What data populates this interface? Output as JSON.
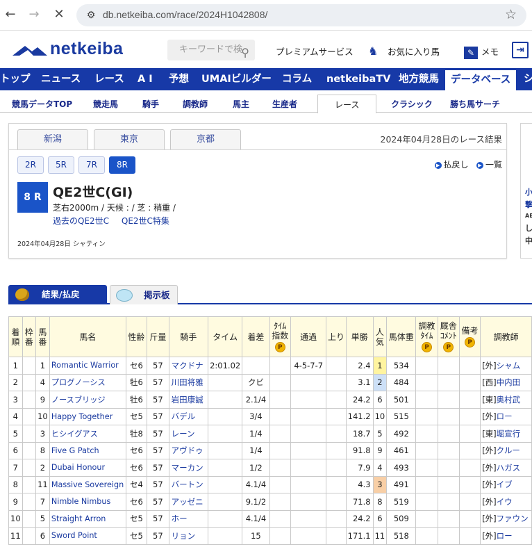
{
  "browser": {
    "url": "db.netkeiba.com/race/2024H1042808/"
  },
  "header": {
    "logo": "netkeiba",
    "search_placeholder": "キーワードで検",
    "premium": "プレミアムサービス",
    "favorites": "お気に入り馬",
    "memo": "メモ"
  },
  "gnav": [
    "トップ",
    "ニュース",
    "レース",
    "A I",
    "予想",
    "UMAIビルダー",
    "コラム",
    "netkeibaTV",
    "地方競馬",
    "データベース",
    "シ"
  ],
  "snav": [
    "競馬データTOP",
    "競走馬",
    "騎手",
    "調教師",
    "馬主",
    "生産者",
    "レース",
    "クラシック",
    "勝ち馬サーチ"
  ],
  "race": {
    "venues": [
      "新潟",
      "東京",
      "京都"
    ],
    "date_result": "2024年04月28日のレース結果",
    "race_tabs": [
      "2R",
      "5R",
      "7R",
      "8R"
    ],
    "link_payout": "払戻し",
    "link_list": "一覧",
    "race_number": "8 R",
    "race_name": "QE2世C(GI)",
    "race_data": "芝右2000m /  天候 :  /  芝 : 稍重  /",
    "past_link": "過去のQE2世C",
    "special_link": "QE2世C特集",
    "info": "2024年04月28日 シャティン"
  },
  "rightad": [
    "小",
    "撃",
    "AE",
    "し",
    "中"
  ],
  "tabs": {
    "result": "結果/払戻",
    "board": "掲示板"
  },
  "table": {
    "headers": [
      "着\n順",
      "枠\n番",
      "馬\n番",
      "馬名",
      "性齢",
      "斤量",
      "騎手",
      "タイム",
      "着差",
      "ﾀｲﾑ\n指数",
      "通過",
      "上り",
      "単勝",
      "人\n気",
      "馬体重",
      "調教\nﾀｲﾑ",
      "厩舎\nｺﾒﾝﾄ",
      "備考",
      "調教師"
    ],
    "premium_mark": "P",
    "rows": [
      {
        "rank": "1",
        "waku": "",
        "num": "1",
        "horse": "Romantic Warrior",
        "sexage": "セ6",
        "weight": "57",
        "jockey": "マクドナ",
        "time": "2:01.02",
        "margin": "",
        "pass": "4-5-7-7",
        "odds": "2.4",
        "pop": "1",
        "body": "534",
        "trainer_region": "[外]",
        "trainer": "シャム"
      },
      {
        "rank": "2",
        "waku": "",
        "num": "4",
        "horse": "プログノーシス",
        "sexage": "牡6",
        "weight": "57",
        "jockey": "川田将雅",
        "time": "",
        "margin": "クビ",
        "pass": "",
        "odds": "3.1",
        "pop": "2",
        "body": "484",
        "trainer_region": "[西]",
        "trainer": "中内田"
      },
      {
        "rank": "3",
        "waku": "",
        "num": "9",
        "horse": "ノースブリッジ",
        "sexage": "牡6",
        "weight": "57",
        "jockey": "岩田康誠",
        "time": "",
        "margin": "2.1/4",
        "pass": "",
        "odds": "24.2",
        "pop": "6",
        "body": "501",
        "trainer_region": "[東]",
        "trainer": "奥村武"
      },
      {
        "rank": "4",
        "waku": "",
        "num": "10",
        "horse": "Happy Together",
        "sexage": "セ5",
        "weight": "57",
        "jockey": "バデル",
        "time": "",
        "margin": "3/4",
        "pass": "",
        "odds": "141.2",
        "pop": "10",
        "body": "515",
        "trainer_region": "[外]",
        "trainer": "ロー"
      },
      {
        "rank": "5",
        "waku": "",
        "num": "3",
        "horse": "ヒシイグアス",
        "sexage": "牡8",
        "weight": "57",
        "jockey": "レーン",
        "time": "",
        "margin": "1/4",
        "pass": "",
        "odds": "18.7",
        "pop": "5",
        "body": "492",
        "trainer_region": "[東]",
        "trainer": "堀宣行"
      },
      {
        "rank": "6",
        "waku": "",
        "num": "8",
        "horse": "Five G Patch",
        "sexage": "セ6",
        "weight": "57",
        "jockey": "アヴドゥ",
        "time": "",
        "margin": "1/4",
        "pass": "",
        "odds": "91.8",
        "pop": "9",
        "body": "461",
        "trainer_region": "[外]",
        "trainer": "クルー"
      },
      {
        "rank": "7",
        "waku": "",
        "num": "2",
        "horse": "Dubai Honour",
        "sexage": "セ6",
        "weight": "57",
        "jockey": "マーカン",
        "time": "",
        "margin": "1/2",
        "pass": "",
        "odds": "7.9",
        "pop": "4",
        "body": "493",
        "trainer_region": "[外]",
        "trainer": "ハガス"
      },
      {
        "rank": "8",
        "waku": "",
        "num": "11",
        "horse": "Massive Sovereign",
        "sexage": "セ4",
        "weight": "57",
        "jockey": "バートン",
        "time": "",
        "margin": "4.1/4",
        "pass": "",
        "odds": "4.3",
        "pop": "3",
        "body": "491",
        "trainer_region": "[外]",
        "trainer": "イブ"
      },
      {
        "rank": "9",
        "waku": "",
        "num": "7",
        "horse": "Nimble Nimbus",
        "sexage": "セ6",
        "weight": "57",
        "jockey": "アッゼニ",
        "time": "",
        "margin": "9.1/2",
        "pass": "",
        "odds": "71.8",
        "pop": "8",
        "body": "519",
        "trainer_region": "[外]",
        "trainer": "イウ"
      },
      {
        "rank": "10",
        "waku": "",
        "num": "5",
        "horse": "Straight Arron",
        "sexage": "セ5",
        "weight": "57",
        "jockey": "ホー",
        "time": "",
        "margin": "4.1/4",
        "pass": "",
        "odds": "24.2",
        "pop": "6",
        "body": "509",
        "trainer_region": "[外]",
        "trainer": "ファウン"
      },
      {
        "rank": "11",
        "waku": "",
        "num": "6",
        "horse": "Sword Point",
        "sexage": "セ5",
        "weight": "57",
        "jockey": "リョン",
        "time": "",
        "margin": "15",
        "pass": "",
        "odds": "171.1",
        "pop": "11",
        "body": "518",
        "trainer_region": "[外]",
        "trainer": "ロー"
      }
    ]
  }
}
